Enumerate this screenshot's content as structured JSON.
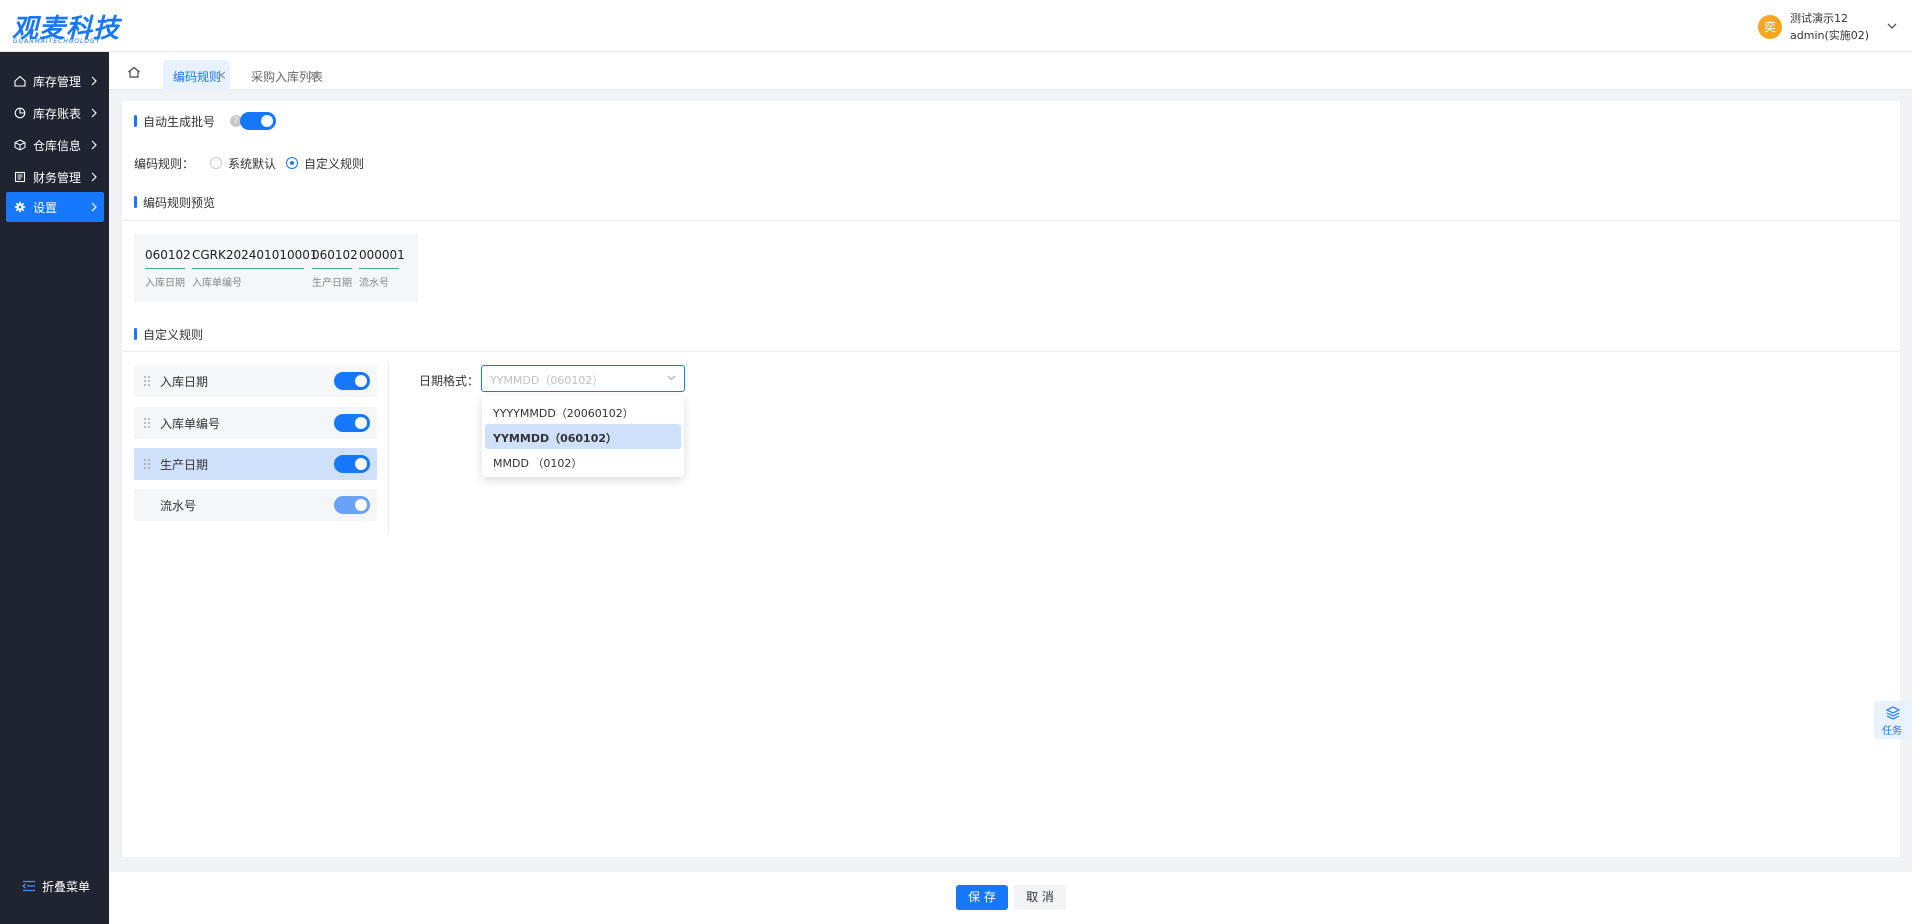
{
  "app": {
    "logo_text": "观麦科技",
    "logo_sub": "GUANMAITECHNOLOGY"
  },
  "user": {
    "avatar_text": "奕",
    "name": "测试演示12",
    "role": "admin(实施02)"
  },
  "sidebar": {
    "items": [
      {
        "label": "库存管理",
        "icon": "home-icon"
      },
      {
        "label": "库存账表",
        "icon": "chart-icon"
      },
      {
        "label": "仓库信息",
        "icon": "cube-icon"
      },
      {
        "label": "财务管理",
        "icon": "ledger-icon"
      },
      {
        "label": "设置",
        "icon": "gear-icon"
      }
    ],
    "active_index": 4,
    "collapse_label": "折叠菜单"
  },
  "tabs": [
    {
      "label": "编码规则",
      "active": true
    },
    {
      "label": "采购入库列表",
      "active": false
    }
  ],
  "auto_batch": {
    "label": "自动生成批号",
    "enabled": true
  },
  "code_rule": {
    "label": "编码规则：",
    "options": [
      "系统默认",
      "自定义规则"
    ],
    "selected": "自定义规则"
  },
  "preview": {
    "title": "编码规则预览",
    "segments": [
      {
        "value": "060102",
        "label": "入库日期"
      },
      {
        "value": "CGRK202401010001",
        "label": "入库单编号"
      },
      {
        "value": "060102",
        "label": "生产日期"
      },
      {
        "value": "000001",
        "label": "流水号"
      }
    ]
  },
  "custom": {
    "title": "自定义规则",
    "items": [
      {
        "label": "入库日期",
        "enabled": true,
        "draggable": true
      },
      {
        "label": "入库单编号",
        "enabled": true,
        "draggable": true
      },
      {
        "label": "生产日期",
        "enabled": true,
        "draggable": true,
        "selected": true
      },
      {
        "label": "流水号",
        "enabled": true,
        "draggable": false
      }
    ]
  },
  "date_format": {
    "label": "日期格式：",
    "placeholder": "YYMMDD（060102）",
    "options": [
      "YYYYMMDD（20060102）",
      "YYMMDD（060102）",
      "MMDD （0102）"
    ],
    "highlighted": "YYMMDD（060102）"
  },
  "task": {
    "label": "任务"
  },
  "footer": {
    "save_label": "保 存",
    "cancel_label": "取 消"
  },
  "colors": {
    "primary": "#1677ff",
    "sidebar_bg": "#1f2430",
    "segment_underline": "#36b37e"
  }
}
